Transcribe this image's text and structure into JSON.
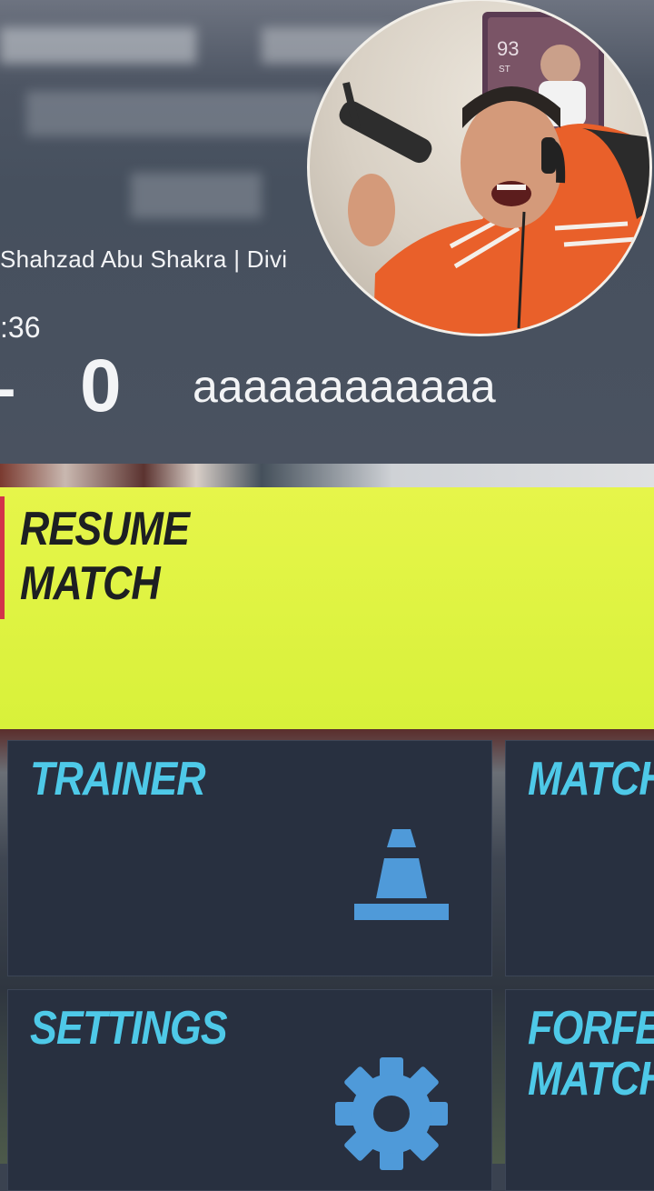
{
  "header": {
    "match_info": "Shahzad Abu Shakra | Divi",
    "match_time": ":36",
    "score_separator": "-",
    "score": "0",
    "opponent": "aaaaaaaaaaaa"
  },
  "menu": {
    "resume": "RESUME\nMATCH",
    "trainer": "TRAINER",
    "match": "MATCH",
    "settings": "SETTINGS",
    "forfeit": "FORFEI\nMATCH"
  },
  "webcam": {
    "card_rating": "93",
    "card_position": "ST"
  },
  "colors": {
    "resume_tile": "#e0f346",
    "tile_label": "#4ec9e8",
    "tile_bg": "#283040",
    "icon": "#4f9ad9"
  },
  "icons": {
    "trainer": "traffic-cone-icon",
    "settings": "gear-icon"
  }
}
